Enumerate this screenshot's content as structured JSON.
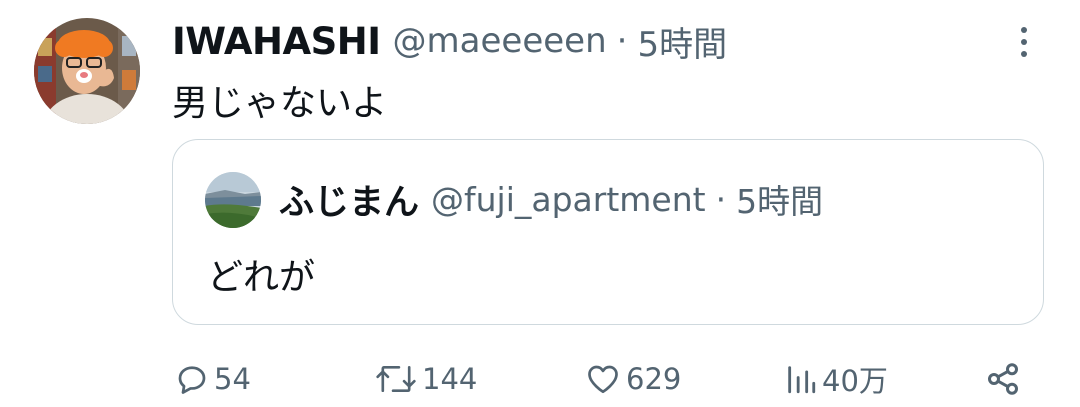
{
  "tweet": {
    "author_name": "IWAHASHI",
    "author_handle": "@maeeeeen",
    "separator": "·",
    "time": "5時間",
    "text": "男じゃないよ",
    "avatar_icon": "profile-photo-icon",
    "menu_icon": "more-vertical-icon"
  },
  "quote": {
    "author_name": "ふじまん",
    "author_handle": "@fuji_apartment",
    "separator": "·",
    "time": "5時間",
    "text": "どれが",
    "avatar_icon": "landscape-photo-icon"
  },
  "actions": {
    "reply": {
      "icon": "reply-icon",
      "count": "54"
    },
    "retweet": {
      "icon": "retweet-icon",
      "count": "144"
    },
    "like": {
      "icon": "heart-icon",
      "count": "629"
    },
    "views": {
      "icon": "views-chart-icon",
      "count": "40万"
    },
    "share": {
      "icon": "share-icon"
    }
  },
  "colors": {
    "text_primary": "#0f1419",
    "text_secondary": "#536471",
    "border": "#cfd9de",
    "background": "#ffffff"
  }
}
